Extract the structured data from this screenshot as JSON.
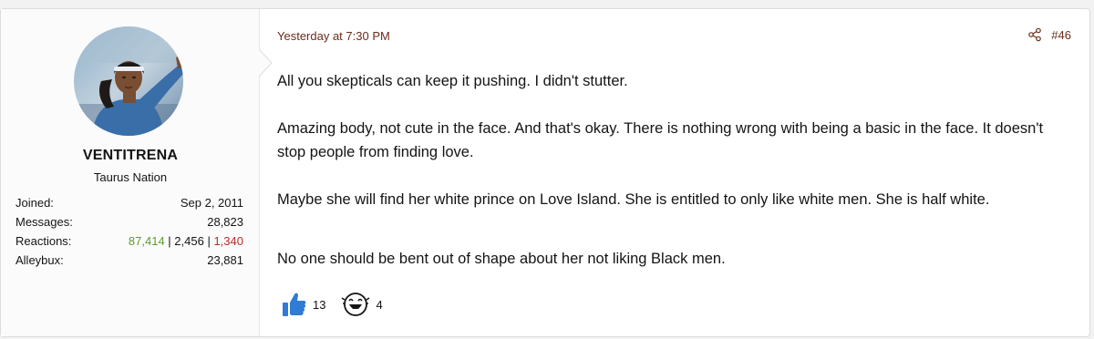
{
  "user": {
    "username": "VENTITRENA",
    "title": "Taurus Nation",
    "stats": {
      "joined_label": "Joined:",
      "joined_value": "Sep 2, 2011",
      "messages_label": "Messages:",
      "messages_value": "28,823",
      "reactions_label": "Reactions:",
      "reactions_positive": "87,414",
      "reactions_sep1": " | ",
      "reactions_neutral": "2,456",
      "reactions_sep2": " | ",
      "reactions_negative": "1,340",
      "alleybux_label": "Alleybux:",
      "alleybux_value": "23,881"
    }
  },
  "post": {
    "timestamp": "Yesterday at 7:30 PM",
    "number": "#46",
    "share_icon": "share-icon",
    "paragraphs": [
      "All you skepticals can keep it pushing. I didn't stutter.",
      "Amazing body, not cute in the face. And that's okay. There is nothing wrong with being a basic in the face. It doesn't stop people from finding love.",
      "Maybe she will find her white prince on Love Island. She is entitled to only like white men. She is half white.",
      "No one should be bent out of shape about her not liking Black men."
    ]
  },
  "reactions": [
    {
      "icon": "thumbs-up-icon",
      "count": "13"
    },
    {
      "icon": "laughing-face-icon",
      "count": "4"
    }
  ],
  "colors": {
    "link": "#6c2d1a",
    "positive": "#5e9b2c",
    "negative": "#b82c2c",
    "like_blue": "#2f7bd6"
  }
}
